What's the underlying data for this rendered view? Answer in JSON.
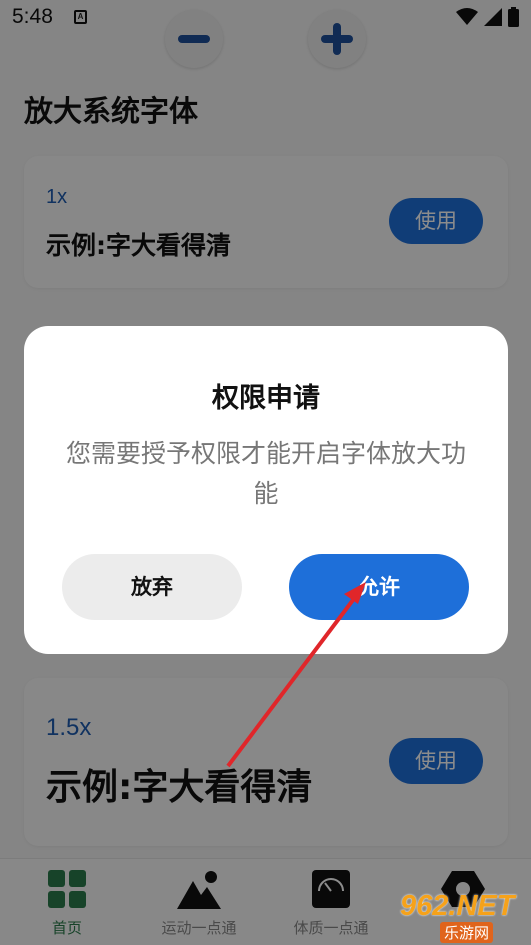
{
  "status": {
    "time": "5:48",
    "notif_letter": "A"
  },
  "zoom": {
    "minus_icon": "minus-icon",
    "plus_icon": "plus-icon",
    "color": "#1e4f9a"
  },
  "page": {
    "title": "放大系统字体"
  },
  "cards": [
    {
      "scale": "1x",
      "example": "示例:字大看得清",
      "button": "使用"
    },
    {
      "scale": "1.5x",
      "example": "示例:字大看得清",
      "button": "使用"
    }
  ],
  "nav": {
    "items": [
      {
        "label": "首页",
        "icon": "grid-icon"
      },
      {
        "label": "运动一点通",
        "icon": "mountain-icon"
      },
      {
        "label": "体质一点通",
        "icon": "scale-icon"
      },
      {
        "label": "",
        "icon": "hexagon-icon"
      }
    ]
  },
  "dialog": {
    "title": "权限申请",
    "message": "您需要授予权限才能开启字体放大功能",
    "cancel": "放弃",
    "allow": "允许"
  },
  "watermark": {
    "text": "962.NET",
    "sub": "乐游网"
  },
  "colors": {
    "accent": "#1e6fd9",
    "scale_text": "#1e5bb0",
    "arrow": "#e0262a",
    "home_green": "#2b7a4b"
  }
}
